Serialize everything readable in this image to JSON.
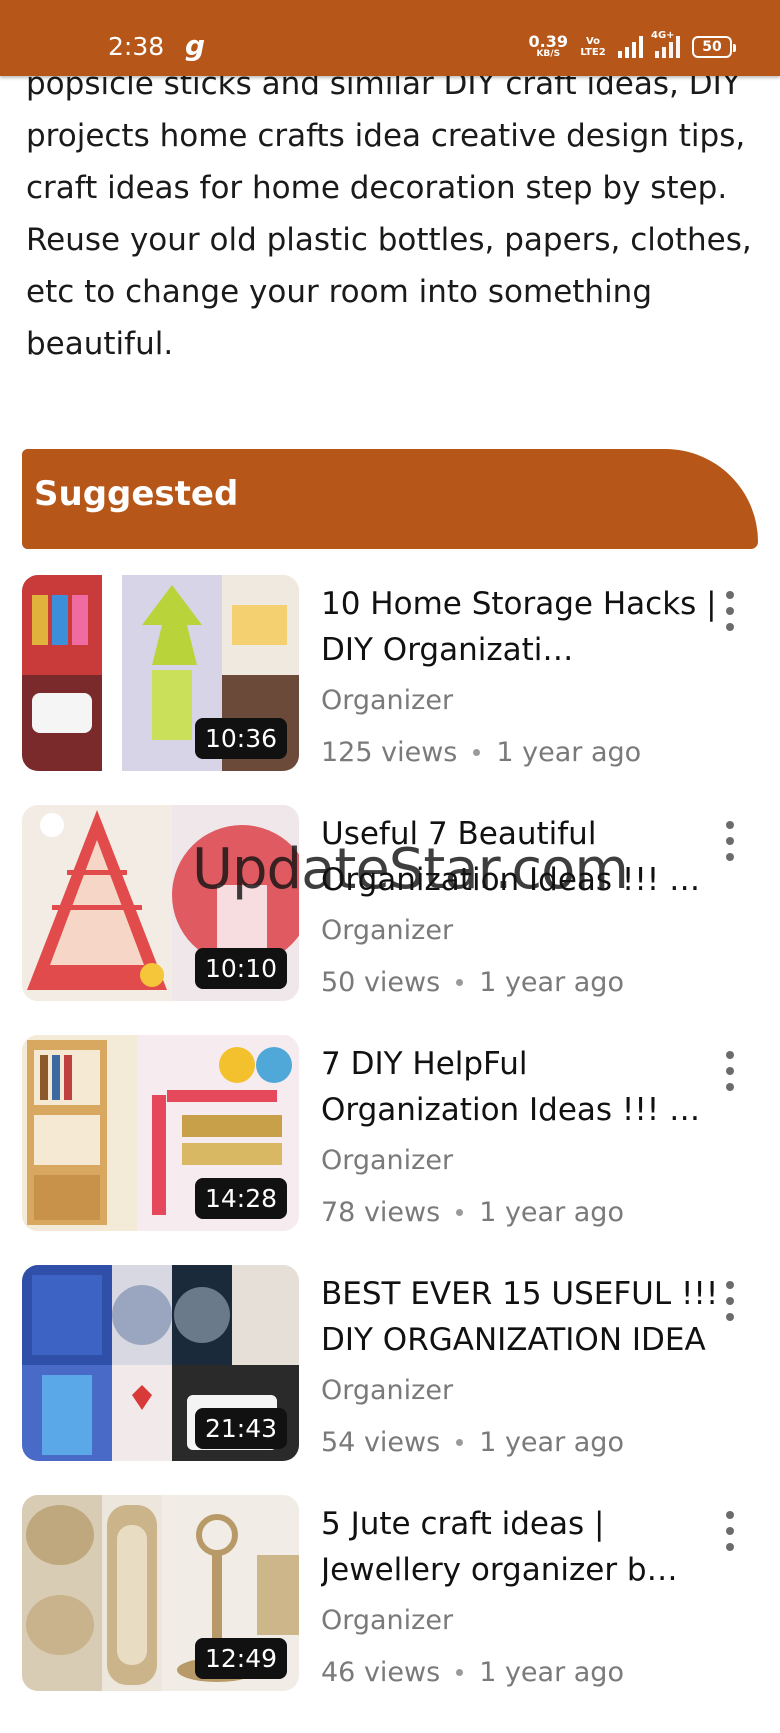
{
  "status_bar": {
    "time": "2:38",
    "app_icon": "g",
    "net_speed_value": "0.39",
    "net_speed_unit": "KB/S",
    "volte_label": "Vo LTE2",
    "network_label": "4G+",
    "battery": "50"
  },
  "description": {
    "text": "popsicle sticks and similar DIY craft ideas, DIY projects home crafts idea creative design tips, craft ideas for home decoration step by step. Reuse your old plastic bottles, papers, clothes, etc to change your room into something beautiful."
  },
  "suggested": {
    "label": "Suggested"
  },
  "videos": [
    {
      "title": "10 Home Storage Hacks | DIY Organizati…",
      "duration": "10:36",
      "channel": "Organizer",
      "views": "125 views",
      "age": "1 year ago"
    },
    {
      "title": "Useful 7 Beautiful Organization Ideas !!! …",
      "duration": "10:10",
      "channel": "Organizer",
      "views": "50 views",
      "age": "1 year ago"
    },
    {
      "title": "7 DIY HelpFul Organization Ideas !!! …",
      "duration": "14:28",
      "channel": "Organizer",
      "views": "78 views",
      "age": "1 year ago"
    },
    {
      "title": "BEST EVER 15 USEFUL !!! DIY ORGANIZATION IDEA",
      "duration": "21:43",
      "channel": "Organizer",
      "views": "54 views",
      "age": "1 year ago"
    },
    {
      "title": "5 Jute craft ideas | Jewellery organizer b…",
      "duration": "12:49",
      "channel": "Organizer",
      "views": "46 views",
      "age": "1 year ago"
    }
  ],
  "watermark": "UpdateStar.com",
  "colors": {
    "accent": "#b65719",
    "text_primary": "#111111",
    "text_secondary": "#7a7a7a"
  }
}
